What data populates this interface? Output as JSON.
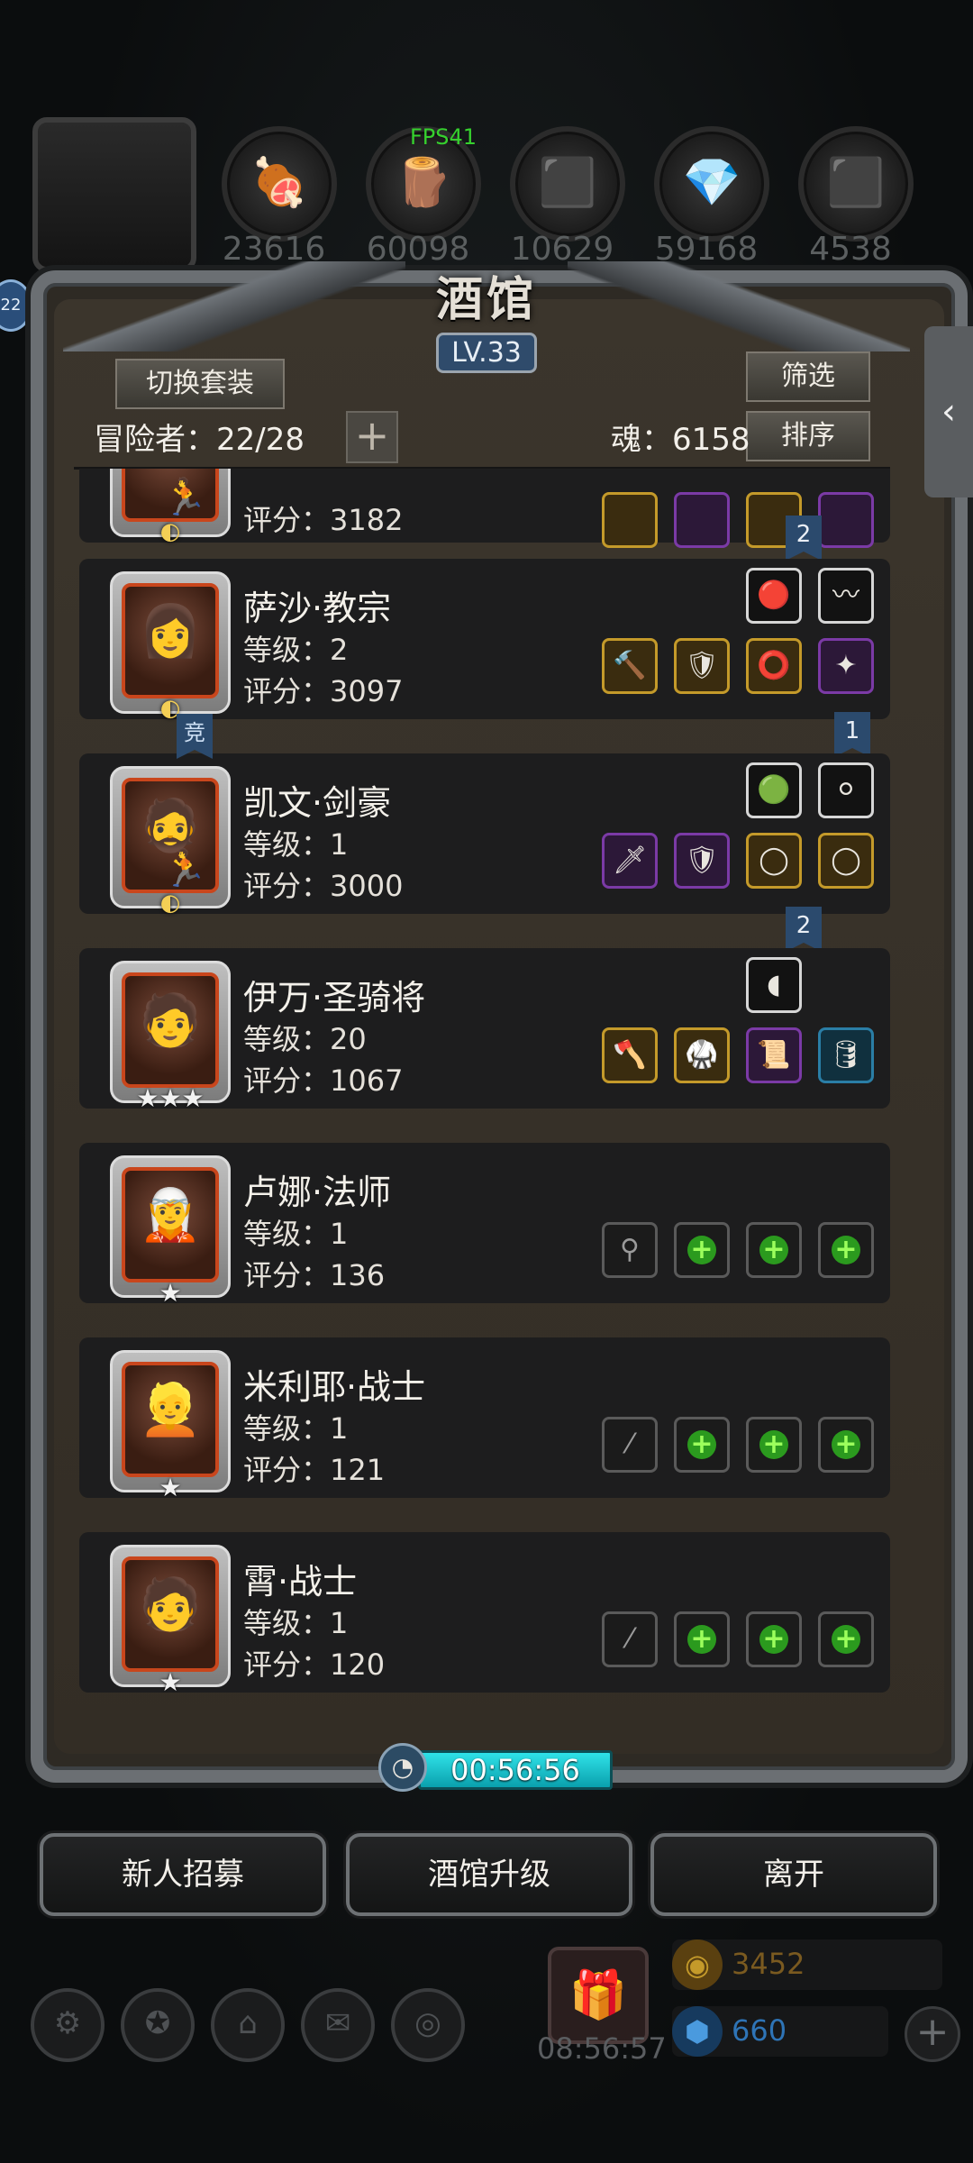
{
  "fps": "FPS41",
  "resources": [
    "23616",
    "60098",
    "10629",
    "59168",
    "4538"
  ],
  "panel": {
    "title": "酒馆",
    "level": "LV.33"
  },
  "header": {
    "switch_label": "切换套装",
    "filter_label": "筛选",
    "sort_label": "排序",
    "adventurers": "冒险者：22/28",
    "soul": "魂：6158"
  },
  "heroes": [
    {
      "name": "",
      "level": "",
      "score": "评分：3182"
    },
    {
      "name": "萨沙·教宗",
      "level": "等级：2",
      "score": "评分：3097",
      "ribbon": "2"
    },
    {
      "name": "凯文·剑豪",
      "level": "等级：1",
      "score": "评分：3000",
      "ribbon": "1"
    },
    {
      "name": "伊万·圣骑将",
      "level": "等级：20",
      "score": "评分：1067",
      "ribbon": "2"
    },
    {
      "name": "卢娜·法师",
      "level": "等级：1",
      "score": "评分：136"
    },
    {
      "name": "米利耶·战士",
      "level": "等级：1",
      "score": "评分：121"
    },
    {
      "name": "霄·战士",
      "level": "等级：1",
      "score": "评分：120"
    }
  ],
  "tag_jing": "竞",
  "timer": "00:56:56",
  "buttons": {
    "recruit": "新人招募",
    "upgrade": "酒馆升级",
    "leave": "离开"
  },
  "footer": {
    "gift_time": "08:56:57",
    "gold": "3452",
    "gems": "660"
  },
  "colors": {
    "accent_cyan": "#2fe2e8",
    "gold_text": "#7a5a20",
    "gem_text": "#2e74b6"
  }
}
